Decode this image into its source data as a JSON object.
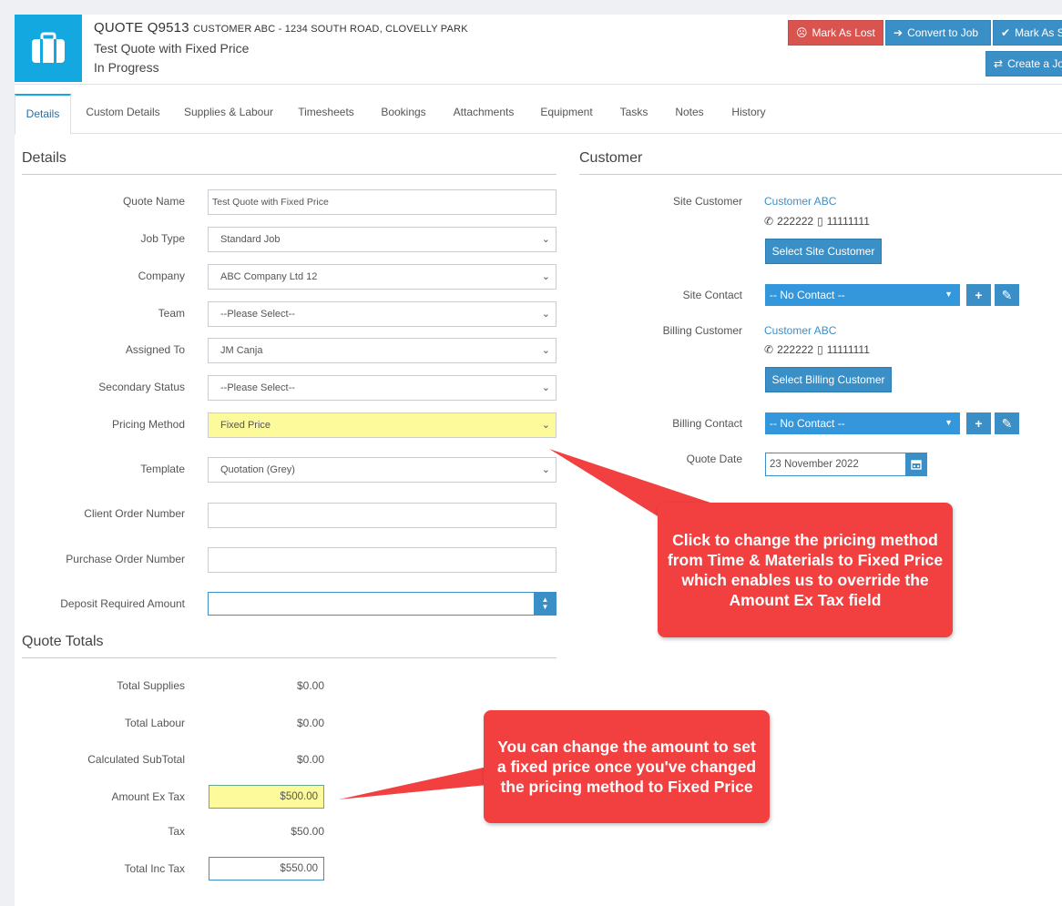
{
  "header": {
    "quote_id": "QUOTE Q9513",
    "customer_address": "CUSTOMER ABC - 1234 SOUTH ROAD, CLOVELLY PARK",
    "quote_title": "Test Quote with Fixed Price",
    "status": "In Progress",
    "buttons": {
      "mark_as_lost": "Mark As Lost",
      "convert_to_job": "Convert to Job",
      "mark_as": "Mark As S",
      "create_job": "Create a Jo"
    }
  },
  "tabs": [
    "Details",
    "Custom Details",
    "Supplies & Labour",
    "Timesheets",
    "Bookings",
    "Attachments",
    "Equipment",
    "Tasks",
    "Notes",
    "History"
  ],
  "details": {
    "heading": "Details",
    "fields": {
      "quote_name": {
        "label": "Quote Name",
        "value": "Test Quote with Fixed Price"
      },
      "job_type": {
        "label": "Job Type",
        "value": "Standard Job"
      },
      "company": {
        "label": "Company",
        "value": "ABC Company Ltd 12"
      },
      "team": {
        "label": "Team",
        "value": "--Please Select--"
      },
      "assigned_to": {
        "label": "Assigned To",
        "value": "JM Canja"
      },
      "secondary_status": {
        "label": "Secondary Status",
        "value": "--Please Select--"
      },
      "pricing_method": {
        "label": "Pricing Method",
        "value": "Fixed Price"
      },
      "template": {
        "label": "Template",
        "value": "Quotation (Grey)"
      },
      "client_order_number": {
        "label": "Client Order Number",
        "value": ""
      },
      "purchase_order_number": {
        "label": "Purchase Order Number",
        "value": ""
      },
      "deposit_required_amount": {
        "label": "Deposit Required Amount",
        "value": ""
      }
    }
  },
  "quote_totals": {
    "heading": "Quote Totals",
    "total_supplies": {
      "label": "Total Supplies",
      "value": "$0.00"
    },
    "total_labour": {
      "label": "Total Labour",
      "value": "$0.00"
    },
    "calculated_subtotal": {
      "label": "Calculated SubTotal",
      "value": "$0.00"
    },
    "amount_ex_tax": {
      "label": "Amount Ex Tax",
      "value": "$500.00"
    },
    "tax": {
      "label": "Tax",
      "value": "$50.00"
    },
    "total_inc_tax": {
      "label": "Total Inc Tax",
      "value": "$550.00"
    }
  },
  "customer": {
    "heading": "Customer",
    "site_customer": {
      "label": "Site Customer",
      "name": "Customer ABC",
      "phone": "222222",
      "mobile": "11111111",
      "button": "Select Site Customer"
    },
    "site_contact": {
      "label": "Site Contact",
      "value": "-- No Contact --"
    },
    "billing_customer": {
      "label": "Billing Customer",
      "name": "Customer ABC",
      "phone": "222222",
      "mobile": "11111111",
      "button": "Select Billing Customer"
    },
    "billing_contact": {
      "label": "Billing Contact",
      "value": "-- No Contact --"
    },
    "quote_date": {
      "label": "Quote Date",
      "value": "23 November 2022"
    }
  },
  "callouts": {
    "pricing": "Click to change the pricing method from Time & Materials to Fixed Price which enables us to override the Amount Ex Tax field",
    "amount": "You can change the amount to set a fixed price once you've changed the pricing method to Fixed Price"
  },
  "colors": {
    "accent": "#13a8e0",
    "button_blue": "#3b8fc7",
    "danger": "#d9534f",
    "highlight_yellow": "#fdfa9b",
    "callout_red": "#f23f3f"
  }
}
